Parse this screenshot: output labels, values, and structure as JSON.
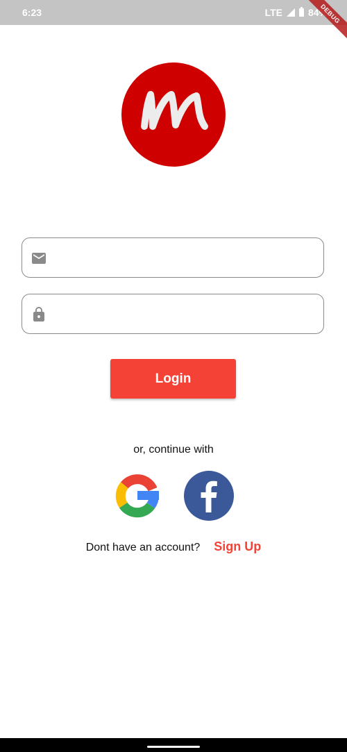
{
  "status_bar": {
    "time": "6:23",
    "network": "LTE",
    "battery": "84%"
  },
  "debug_ribbon": "DEBUG",
  "login_form": {
    "email": {
      "value": "",
      "placeholder": ""
    },
    "password": {
      "value": "",
      "placeholder": ""
    },
    "login_label": "Login"
  },
  "social": {
    "prompt": "or, continue with",
    "providers": [
      "google-icon",
      "facebook-icon"
    ]
  },
  "signup": {
    "question": "Dont have an account?",
    "link_label": "Sign Up"
  },
  "colors": {
    "accent": "#f44336",
    "logo": "#cf0000",
    "facebook": "#3b5998",
    "status_bar": "#c4c4c4"
  }
}
